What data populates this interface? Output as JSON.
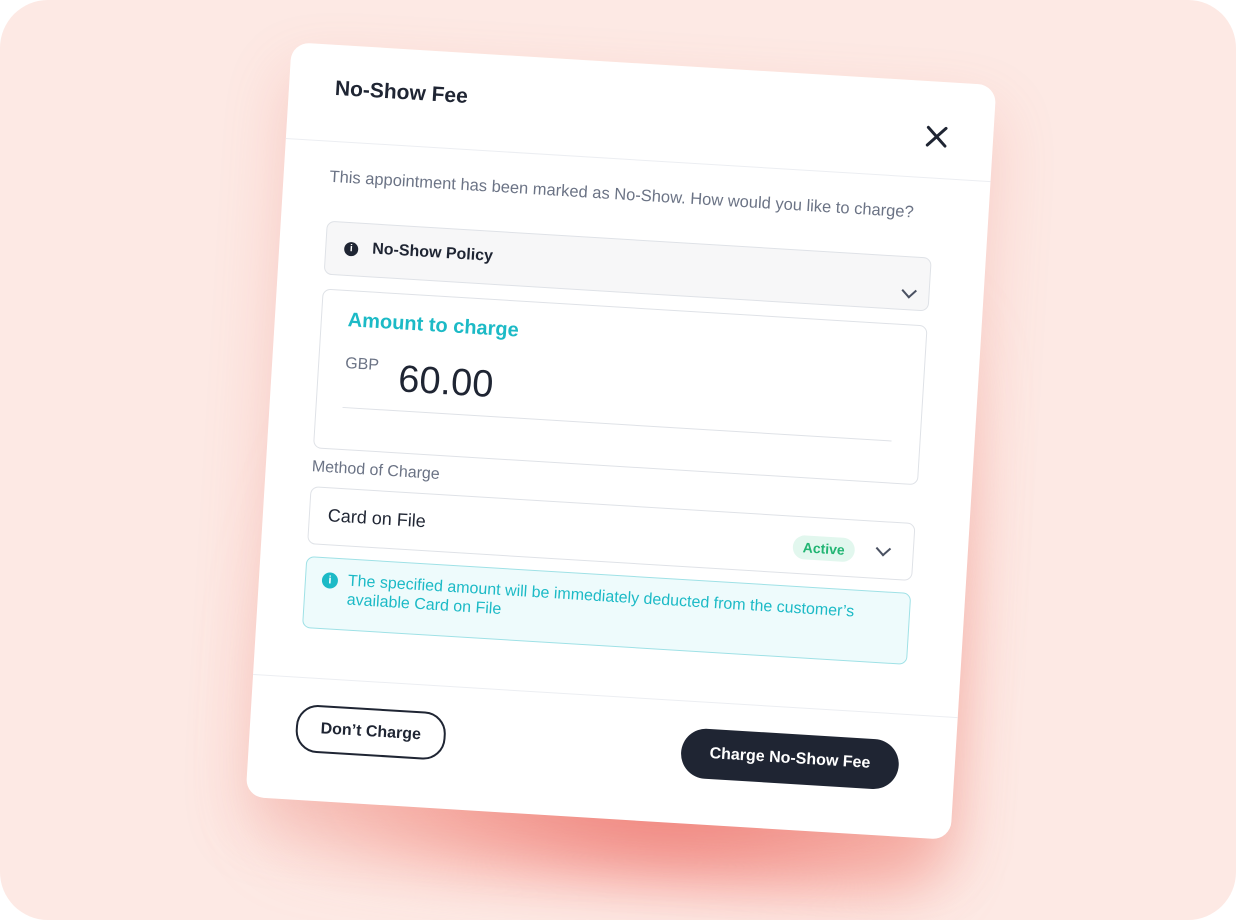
{
  "modal": {
    "title": "No-Show Fee",
    "intro": "This appointment has been marked as No-Show. How would you like to charge?"
  },
  "policy": {
    "label": "No-Show Policy"
  },
  "amount": {
    "title": "Amount to charge",
    "currency": "GBP",
    "value": "60.00"
  },
  "method": {
    "label": "Method of Charge",
    "selected": "Card on File",
    "status": "Active"
  },
  "notice": {
    "text": "The specified amount will be immediately deducted from the customer’s available Card on File"
  },
  "footer": {
    "dont_charge_label": "Don’t Charge",
    "charge_label": "Charge No-Show Fee"
  },
  "colors": {
    "accent": "#1cbac6",
    "dark": "#1f2533",
    "success": "#22b573",
    "background": "#fde9e4"
  }
}
